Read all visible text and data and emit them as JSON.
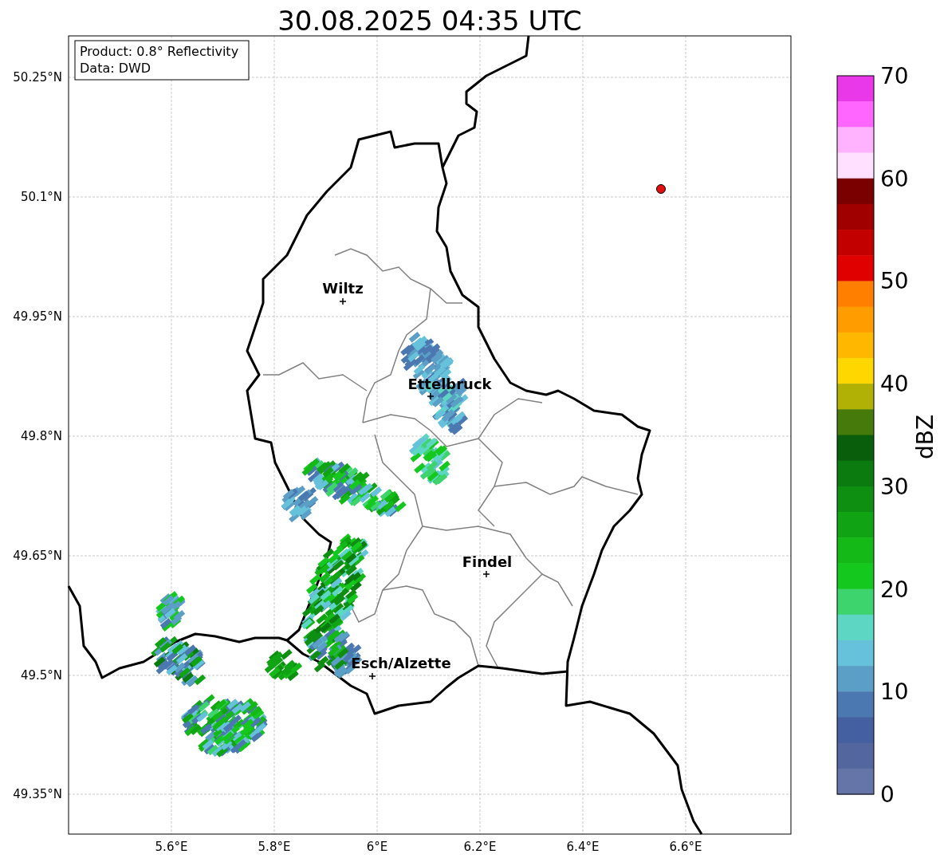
{
  "title": "30.08.2025 04:35 UTC",
  "info_box": [
    "Product: 0.8° Reflectivity",
    "Data: DWD"
  ],
  "map": {
    "lat_ticks": [
      "50.25°N",
      "50.1°N",
      "49.95°N",
      "49.8°N",
      "49.65°N",
      "49.5°N",
      "49.35°N"
    ],
    "lon_ticks": [
      "5.6°E",
      "5.8°E",
      "6°E",
      "6.2°E",
      "6.4°E",
      "6.6°E"
    ],
    "cities": [
      "Wiltz",
      "Ettelbruck",
      "Findel",
      "Esch/Alzette"
    ]
  },
  "colorbar": {
    "label": "dBZ",
    "ticks": [
      "70",
      "60",
      "50",
      "40",
      "30",
      "20",
      "10",
      "0"
    ],
    "bins": [
      {
        "color": "#e838e8"
      },
      {
        "color": "#ff66ff"
      },
      {
        "color": "#ffb3ff"
      },
      {
        "color": "#ffe0ff"
      },
      {
        "color": "#7a0000"
      },
      {
        "color": "#a00000"
      },
      {
        "color": "#c20000"
      },
      {
        "color": "#e00000"
      },
      {
        "color": "#ff7f00"
      },
      {
        "color": "#ff9c00"
      },
      {
        "color": "#ffb700"
      },
      {
        "color": "#ffd700"
      },
      {
        "color": "#b0b005"
      },
      {
        "color": "#467a0a"
      },
      {
        "color": "#085e0b"
      },
      {
        "color": "#0b7a0f"
      },
      {
        "color": "#0e8f12"
      },
      {
        "color": "#10a414"
      },
      {
        "color": "#14b817"
      },
      {
        "color": "#15c81d"
      },
      {
        "color": "#3dd46e"
      },
      {
        "color": "#5ed6c4"
      },
      {
        "color": "#66c2db"
      },
      {
        "color": "#5b9ec6"
      },
      {
        "color": "#4b78b0"
      },
      {
        "color": "#4560a0"
      },
      {
        "color": "#54669e"
      },
      {
        "color": "#6575a8"
      }
    ]
  }
}
